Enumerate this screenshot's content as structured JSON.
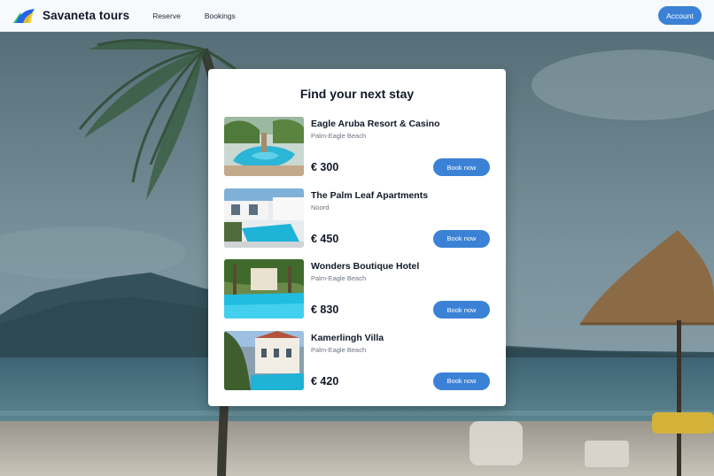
{
  "header": {
    "brand_name": "Savaneta tours",
    "nav": [
      {
        "label": "Reserve"
      },
      {
        "label": "Bookings"
      }
    ],
    "account_label": "Account",
    "logo_colors": [
      "#2563eb",
      "#22c55e",
      "#facc15"
    ]
  },
  "card": {
    "title": "Find your next stay"
  },
  "hotels": [
    {
      "name": "Eagle Aruba Resort & Casino",
      "location": "Palm-Eagle Beach",
      "price": "€ 300",
      "book_label": "Book now"
    },
    {
      "name": "The Palm Leaf Apartments",
      "location": "Noord",
      "price": "€ 450",
      "book_label": "Book now"
    },
    {
      "name": "Wonders Boutique Hotel",
      "location": "Palm-Eagle Beach",
      "price": "€ 830",
      "book_label": "Book now"
    },
    {
      "name": "Kamerlingh Villa",
      "location": "Palm-Eagle Beach",
      "price": "€ 420",
      "book_label": "Book now"
    }
  ],
  "colors": {
    "accent": "#3b82d6",
    "header_bg": "#f7fafc",
    "card_bg": "#ffffff"
  }
}
